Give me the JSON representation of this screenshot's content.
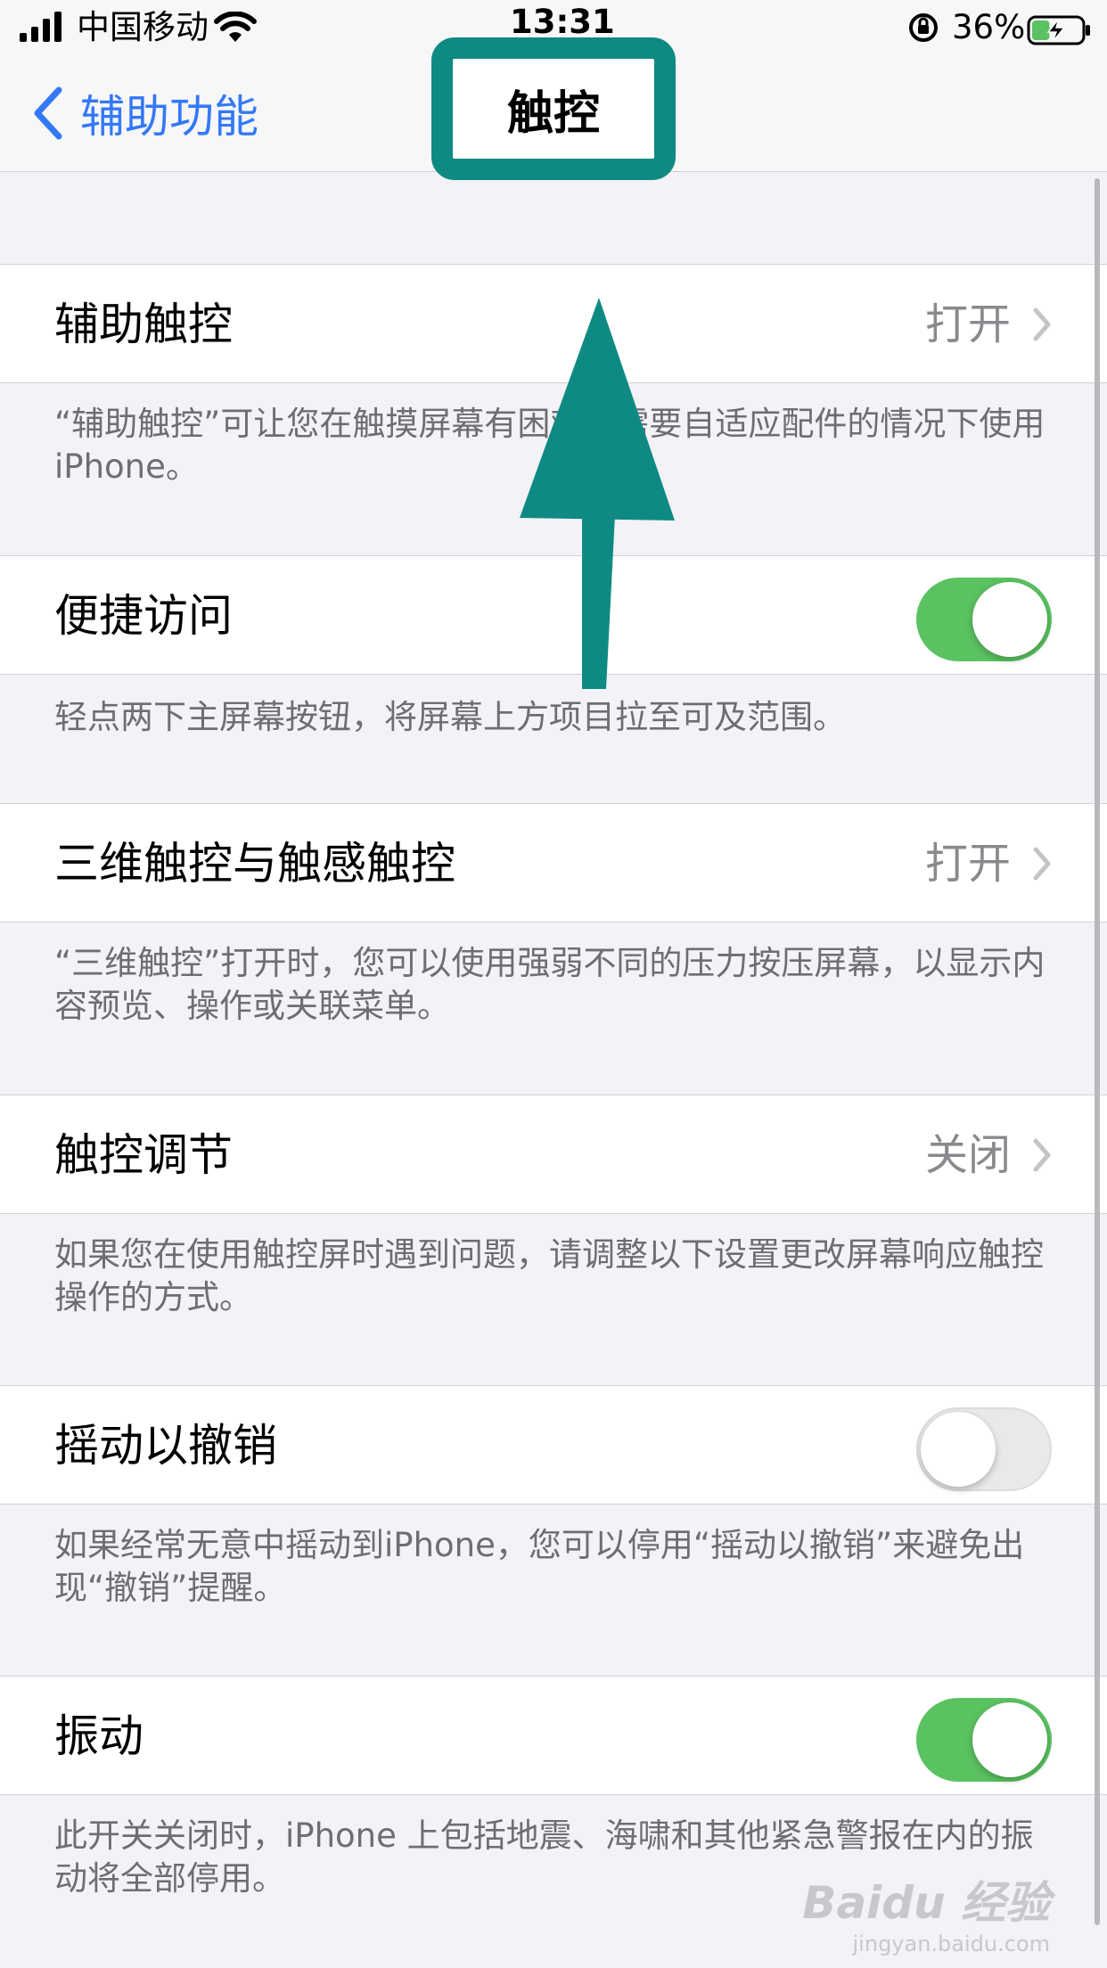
{
  "status_bar": {
    "carrier": "中国移动",
    "time": "13:31",
    "battery": "36%",
    "battery_level": 0.36
  },
  "nav": {
    "back_label": "辅助功能",
    "title": "触控"
  },
  "rows": [
    {
      "label": "辅助触控",
      "value": "打开",
      "footnote": "“辅助触控”可让您在触摸屏幕有困难或需要自适应配件的情况下使用 iPhone。"
    },
    {
      "label": "便捷访问",
      "toggle": true,
      "footnote": "轻点两下主屏幕按钮，将屏幕上方项目拉至可及范围。"
    },
    {
      "label": "三维触控与触感触控",
      "value": "打开",
      "footnote": "“三维触控”打开时，您可以使用强弱不同的压力按压屏幕，以显示内容预览、操作或关联菜单。"
    },
    {
      "label": "触控调节",
      "value": "关闭",
      "footnote": "如果您在使用触控屏时遇到问题，请调整以下设置更改屏幕响应触控操作的方式。"
    },
    {
      "label": "摇动以撤销",
      "toggle": false,
      "footnote": "如果经常无意中摇动到iPhone，您可以停用“摇动以撤销”来避免出现“撤销”提醒。"
    },
    {
      "label": "振动",
      "toggle": true,
      "footnote": "此开关关闭时，iPhone 上包括地震、海啸和其他紧急警报在内的振动将全部停用。"
    }
  ],
  "colors": {
    "accent": "#3478f6",
    "toggle_on": "#5ac260",
    "annotation": "#0f8a82"
  },
  "watermark": {
    "logo": "Baidu 经验",
    "url": "jingyan.baidu.com"
  }
}
